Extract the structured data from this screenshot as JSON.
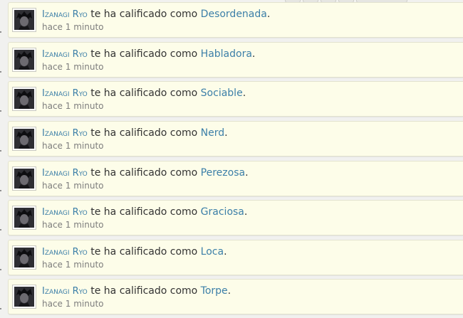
{
  "notifications": [
    {
      "user": "Izanagi Ryo",
      "action": "te ha calificado como",
      "trait": "Desordenada",
      "punct": ".",
      "time": "hace 1 minuto",
      "avatar": "user-avatar"
    },
    {
      "user": "Izanagi Ryo",
      "action": "te ha calificado como",
      "trait": "Habladora",
      "punct": ".",
      "time": "hace 1 minuto",
      "avatar": "user-avatar"
    },
    {
      "user": "Izanagi Ryo",
      "action": "te ha calificado como",
      "trait": "Sociable",
      "punct": ".",
      "time": "hace 1 minuto",
      "avatar": "user-avatar"
    },
    {
      "user": "Izanagi Ryo",
      "action": "te ha calificado como",
      "trait": "Nerd",
      "punct": ".",
      "time": "hace 1 minuto",
      "avatar": "user-avatar"
    },
    {
      "user": "Izanagi Ryo",
      "action": "te ha calificado como",
      "trait": "Perezosa",
      "punct": ".",
      "time": "hace 1 minuto",
      "avatar": "user-avatar"
    },
    {
      "user": "Izanagi Ryo",
      "action": "te ha calificado como",
      "trait": "Graciosa",
      "punct": ".",
      "time": "hace 1 minuto",
      "avatar": "user-avatar"
    },
    {
      "user": "Izanagi Ryo",
      "action": "te ha calificado como",
      "trait": "Loca",
      "punct": ".",
      "time": "hace 1 minuto",
      "avatar": "user-avatar"
    },
    {
      "user": "Izanagi Ryo",
      "action": "te ha calificado como",
      "trait": "Torpe",
      "punct": ".",
      "time": "hace 1 minuto",
      "avatar": "user-avatar"
    }
  ],
  "colors": {
    "card_background": "#fdfde9",
    "link": "#3c7fa8",
    "text": "#333333",
    "timestamp": "#7d7d7d",
    "page_background": "#f1f1ef"
  }
}
